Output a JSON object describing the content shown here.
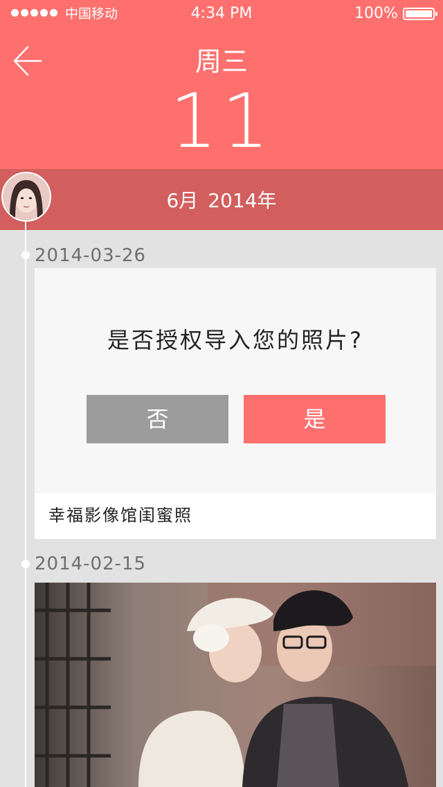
{
  "status_bar": {
    "carrier": "中国移动",
    "time": "4:34 PM",
    "battery_percent": "100%"
  },
  "header": {
    "weekday": "周三",
    "day": "11",
    "month": "6月",
    "year": "2014年"
  },
  "timeline": {
    "entries": [
      {
        "date": "2014-03-26",
        "prompt": "是否授权导入您的照片?",
        "no_label": "否",
        "yes_label": "是",
        "caption": "幸福影像馆闺蜜照"
      },
      {
        "date": "2014-02-15"
      }
    ]
  },
  "colors": {
    "accent": "#fe706e",
    "month_bar": "#d25f5d",
    "no_button": "#9c9c9c",
    "background": "#e2e2e2"
  },
  "icons": {
    "back": "arrow-left-icon",
    "battery": "battery-icon",
    "signal": "signal-dots-icon"
  }
}
